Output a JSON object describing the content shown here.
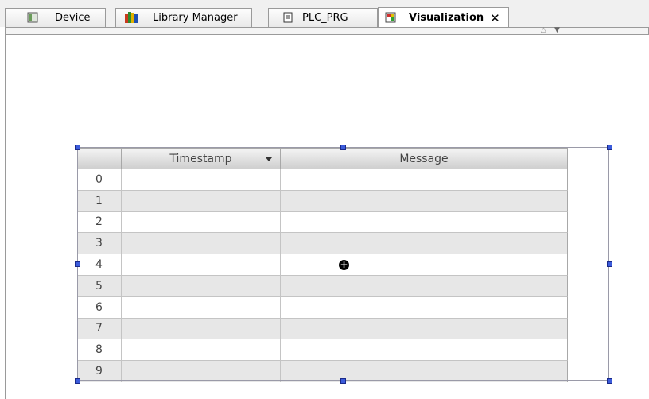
{
  "tabs": [
    {
      "label": "Device",
      "icon": "device-icon"
    },
    {
      "label": "Library Manager",
      "icon": "library-icon"
    },
    {
      "label": "PLC_PRG",
      "icon": "document-icon"
    },
    {
      "label": "Visualization",
      "icon": "visualization-icon",
      "active": true
    }
  ],
  "table": {
    "columns": [
      "",
      "Timestamp",
      "Message"
    ],
    "rows": [
      "0",
      "1",
      "2",
      "3",
      "4",
      "5",
      "6",
      "7",
      "8",
      "9"
    ]
  },
  "colors": {
    "handle": "#3b5bdb",
    "row_alt": "#e7e7e7",
    "header": "#cfcfcf"
  }
}
